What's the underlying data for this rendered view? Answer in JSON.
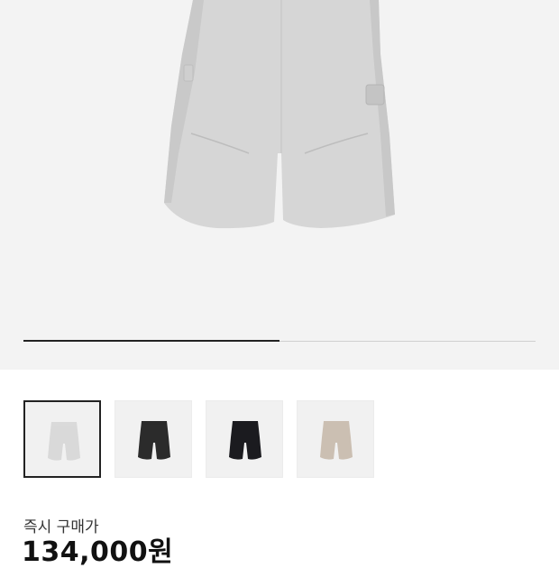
{
  "product": {
    "main_image": "heather-gray-shorts-photo",
    "image_progress": 0.5,
    "thumbnails": [
      {
        "name": "thumb-heather-gray",
        "color": "#d9d9d9",
        "selected": true
      },
      {
        "name": "thumb-charcoal",
        "color": "#2b2b2b",
        "selected": false
      },
      {
        "name": "thumb-black",
        "color": "#1b1b1f",
        "selected": false
      },
      {
        "name": "thumb-beige",
        "color": "#cbbfb2",
        "selected": false
      }
    ],
    "price_label": "즉시 구매가",
    "price": "134,000원"
  },
  "colors": {
    "hero_bg": "#f3f3f3",
    "progress_fill": "#222222",
    "progress_track": "#cfcfcf"
  }
}
